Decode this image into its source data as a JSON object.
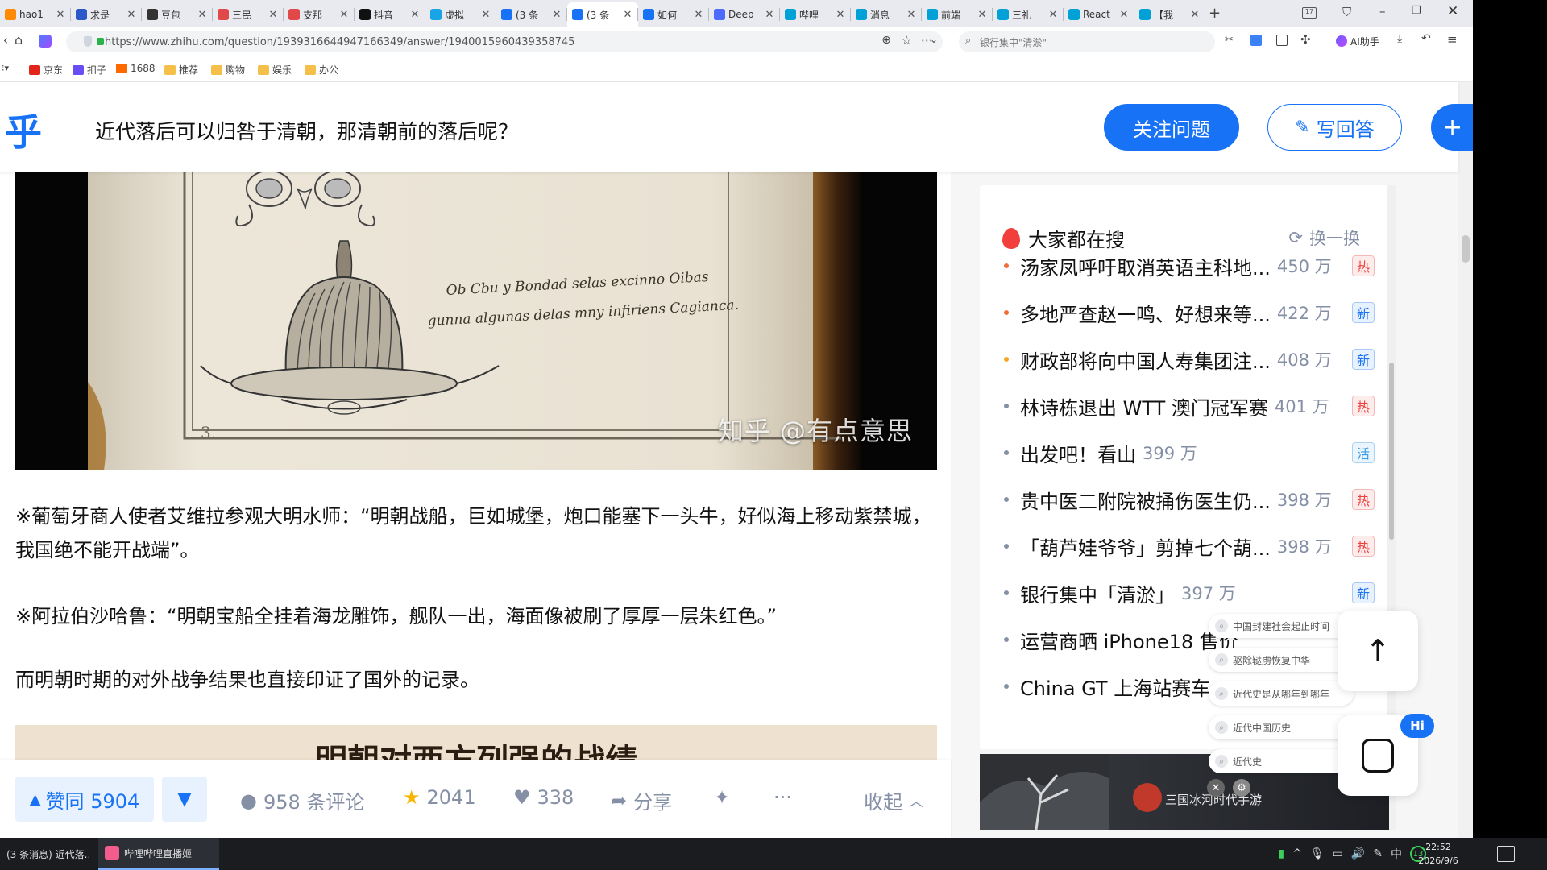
{
  "tabs": [
    {
      "label": "hao1",
      "color": "#ff8a00",
      "icon": "hao123-favicon"
    },
    {
      "label": "求是",
      "color": "#2b58c8",
      "icon": "qiushi-favicon"
    },
    {
      "label": "豆包",
      "color": "#333333",
      "icon": "doubao-favicon"
    },
    {
      "label": "三民",
      "color": "#e0484a",
      "icon": "sanmin-favicon"
    },
    {
      "label": "支那",
      "color": "#e0484a",
      "icon": "zhina-favicon"
    },
    {
      "label": "抖音",
      "color": "#111111",
      "icon": "douyin-favicon"
    },
    {
      "label": "虚拟",
      "color": "#19a4e5",
      "icon": "xuni-favicon"
    },
    {
      "label": "(3 条",
      "color": "#1772f6",
      "icon": "zhihu-favicon"
    },
    {
      "label": "(3 条",
      "color": "#1772f6",
      "icon": "zhihu-favicon"
    },
    {
      "label": "如何",
      "color": "#1772f6",
      "icon": "zhihu-favicon"
    },
    {
      "label": "Deep",
      "color": "#4d6bfe",
      "icon": "deepseek-favicon"
    },
    {
      "label": "哔哩",
      "color": "#00a1d6",
      "icon": "bilibili-favicon"
    },
    {
      "label": "消息",
      "color": "#00a1d6",
      "icon": "bilibili-favicon"
    },
    {
      "label": "前端",
      "color": "#00a1d6",
      "icon": "bilibili-favicon"
    },
    {
      "label": "三礼",
      "color": "#00a1d6",
      "icon": "bilibili-favicon"
    },
    {
      "label": "React",
      "color": "#00a1d6",
      "icon": "bilibili-favicon"
    },
    {
      "label": "【我",
      "color": "#00a1d6",
      "icon": "bilibili-favicon"
    }
  ],
  "active_tab_index": 8,
  "address": {
    "url": "https://www.zhihu.com/question/1939316644947166349/answer/1940015960439358745",
    "search_placeholder": "银行集中\"清淤\"",
    "ai_assistant": "AI助手"
  },
  "bookmarks": [
    {
      "label": "京东",
      "icon": "jd-icon",
      "color": "#e1251b"
    },
    {
      "label": "扣子",
      "icon": "coze-icon",
      "color": "#6a4df5"
    },
    {
      "label": "1688",
      "icon": "1688-icon",
      "color": "#ff6a00"
    },
    {
      "label": "推荐",
      "icon": "folder-icon",
      "color": "#f5c04a"
    },
    {
      "label": "购物",
      "icon": "folder-icon",
      "color": "#f5c04a"
    },
    {
      "label": "娱乐",
      "icon": "folder-icon",
      "color": "#f5c04a"
    },
    {
      "label": "办公",
      "icon": "folder-icon",
      "color": "#f5c04a"
    }
  ],
  "header": {
    "logo": "乎",
    "question_title": "近代落后可以归咎于清朝，那清朝前的落后呢？",
    "follow_label": "关注问题",
    "answer_label": "写回答",
    "plus_label": "+"
  },
  "article": {
    "image_watermark": "知乎 @有点意思",
    "image_script_line1": "Ob Cbu y Bondad selas excinno Oibas",
    "image_script_line2": "gunna algunas delas mny infiriens Cagianca.",
    "para1": "※葡萄牙商人使者艾维拉参观大明水师：“明朝战船，巨如城堡，炮口能塞下一头牛，好似海上移动紫禁城，我国绝不能开战端”。",
    "para2": "※阿拉伯沙哈鲁：“明朝宝船全挂着海龙雕饰，舰队一出，海面像被刷了厚厚一层朱红色。”",
    "para3": "而明朝时期的对外战争结果也直接印证了国外的记录。",
    "image2_title": "明朝对西方列强的战绩"
  },
  "actions": {
    "vote_label": "赞同 5904",
    "comments": "958 条评论",
    "favorites": "2041",
    "likes": "338",
    "share": "分享",
    "more": "···",
    "collapse": "收起"
  },
  "sidebar": {
    "title": "大家都在搜",
    "refresh": "换一换",
    "items": [
      {
        "title": "汤家凤呼吁取消英语主科地...",
        "count": "450 万",
        "tag": "热",
        "tag_type": "hot",
        "dot": "#f26b3a"
      },
      {
        "title": "多地严查赵一鸣、好想来等...",
        "count": "422 万",
        "tag": "新",
        "tag_type": "new",
        "dot": "#f26b3a"
      },
      {
        "title": "财政部将向中国人寿集团注...",
        "count": "408 万",
        "tag": "新",
        "tag_type": "new",
        "dot": "#f5a623"
      },
      {
        "title": "林诗栋退出 WTT 澳门冠军赛",
        "count": "401 万",
        "tag": "热",
        "tag_type": "hot",
        "dot": "#8590a6"
      },
      {
        "title": "出发吧！看山",
        "count": "399 万",
        "tag": "活",
        "tag_type": "live",
        "dot": "#8590a6"
      },
      {
        "title": "贵中医二附院被捅伤医生仍...",
        "count": "398 万",
        "tag": "热",
        "tag_type": "hot",
        "dot": "#8590a6"
      },
      {
        "title": "「葫芦娃爷爷」剪掉七个葫...",
        "count": "398 万",
        "tag": "热",
        "tag_type": "hot",
        "dot": "#8590a6"
      },
      {
        "title": "银行集中「清淤」",
        "count": "397 万",
        "tag": "新",
        "tag_type": "new",
        "dot": "#8590a6"
      },
      {
        "title": "运营商晒 iPhone18 售价",
        "count": "",
        "tag": "",
        "tag_type": "",
        "dot": "#8590a6"
      },
      {
        "title": "China GT 上海站赛车",
        "count": "",
        "tag": "",
        "tag_type": "",
        "dot": "#8590a6"
      }
    ],
    "banner_text": "三国冰河时代手游"
  },
  "suggestions": [
    "中国封建社会起止时间",
    "驱除鞑虏恢复中华",
    "近代史是从哪年到哪年",
    "近代中国历史",
    "近代史"
  ],
  "taskbar": {
    "task1": "(3 条消息) 近代落...",
    "task2": "哔哩哔哩直播姬",
    "ime": "中",
    "badge": "13",
    "time": "22:52",
    "date": "2026/9/6"
  }
}
